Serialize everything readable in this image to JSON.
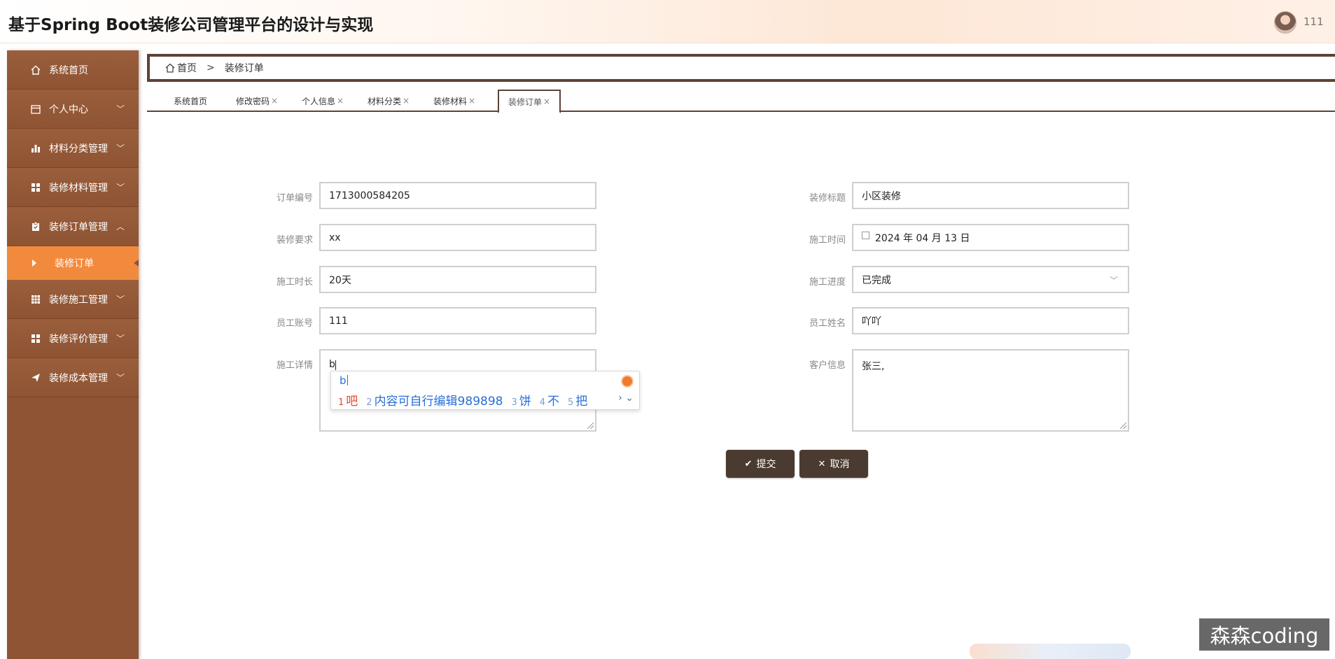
{
  "header": {
    "title": "基于Spring Boot装修公司管理平台的设计与实现",
    "username": "111"
  },
  "sidebar": {
    "items": [
      {
        "label": "系统首页",
        "icon": "home-icon"
      },
      {
        "label": "个人中心",
        "icon": "calendar-icon"
      },
      {
        "label": "材料分类管理",
        "icon": "bar-chart-icon"
      },
      {
        "label": "装修材料管理",
        "icon": "grid-icon"
      },
      {
        "label": "装修订单管理",
        "icon": "clipboard-icon"
      },
      {
        "label": "装修施工管理",
        "icon": "table-icon"
      },
      {
        "label": "装修评价管理",
        "icon": "grid-icon"
      },
      {
        "label": "装修成本管理",
        "icon": "send-icon"
      }
    ],
    "active_sub": "装修订单"
  },
  "breadcrumb": {
    "home": "首页",
    "sep": ">",
    "current": "装修订单"
  },
  "tabs": [
    {
      "label": "系统首页",
      "closable": false
    },
    {
      "label": "修改密码",
      "closable": true
    },
    {
      "label": "个人信息",
      "closable": true
    },
    {
      "label": "材料分类",
      "closable": true
    },
    {
      "label": "装修材料",
      "closable": true
    },
    {
      "label": "装修订单",
      "closable": true,
      "active": true
    }
  ],
  "tab_close": "×",
  "form": {
    "order_no_label": "订单编号",
    "order_no": "1713000584205",
    "title_label": "装修标题",
    "title": "小区装修",
    "req_label": "装修要求",
    "req": "xx",
    "date_label": "施工时间",
    "date": "2024 年 04 月 13 日",
    "duration_label": "施工时长",
    "duration": "20天",
    "progress_label": "施工进度",
    "progress": "已完成",
    "account_label": "员工账号",
    "account": "111",
    "staff_label": "员工姓名",
    "staff": "吖吖",
    "detail_label": "施工详情",
    "detail": "b",
    "customer_label": "客户信息",
    "customer": "张三,"
  },
  "ime": {
    "typed": "b",
    "candidates": [
      {
        "n": "1",
        "text": "吧"
      },
      {
        "n": "2",
        "text": "内容可自行编辑989898"
      },
      {
        "n": "3",
        "text": "饼"
      },
      {
        "n": "4",
        "text": "不"
      },
      {
        "n": "5",
        "text": "把"
      }
    ],
    "nav": "› ⌄"
  },
  "buttons": {
    "submit": "提交",
    "cancel": "取消"
  },
  "watermark": "森森coding",
  "colors": {
    "sidebar": "#8e5433",
    "active_menu": "#f28a3d",
    "button": "#4a3a30",
    "border_dark": "#5c4337"
  }
}
